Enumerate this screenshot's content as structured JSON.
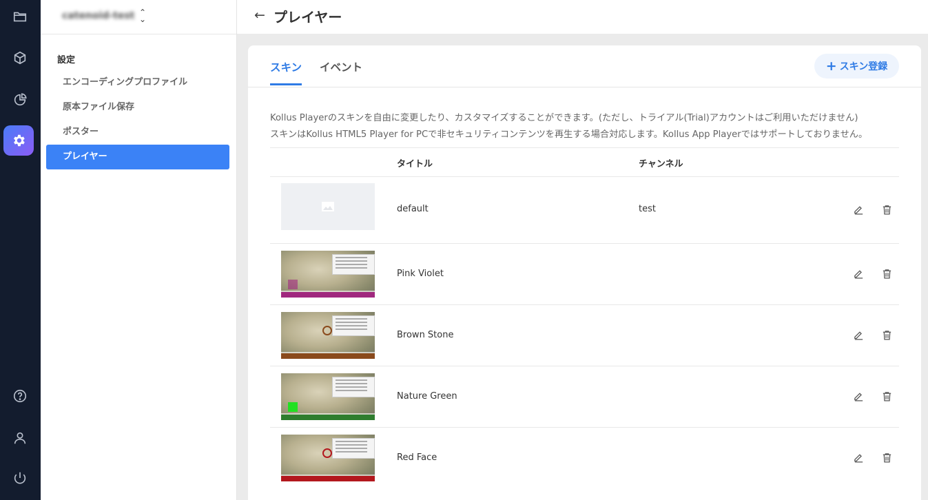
{
  "rail": {
    "items": [
      {
        "icon": "folder-icon"
      },
      {
        "icon": "cube-icon"
      },
      {
        "icon": "pie-chart-icon"
      },
      {
        "icon": "gear-icon"
      },
      {
        "icon": "help-icon"
      },
      {
        "icon": "user-icon"
      },
      {
        "icon": "power-icon"
      }
    ],
    "active_color": "#4a7cf7"
  },
  "sidebar": {
    "workspace": "catenoid-test",
    "section": "設定",
    "items": [
      {
        "label": "エンコーディングプロファイル"
      },
      {
        "label": "原本ファイル保存"
      },
      {
        "label": "ポスター"
      },
      {
        "label": "プレイヤー"
      }
    ]
  },
  "header": {
    "back_icon": "arrow-left-icon",
    "title": "プレイヤー"
  },
  "tabs": [
    {
      "label": "スキン"
    },
    {
      "label": "イベント"
    }
  ],
  "add_button": {
    "label": "スキン登録",
    "icon": "plus-icon"
  },
  "description": {
    "line1": "Kollus Playerのスキンを自由に変更したり、カスタマイズすることができます。(ただし、トライアル(Trial)アカウントはご利用いただけません)",
    "line2": "スキンはKollus HTML5 Player for PCで非セキュリティコンテンツを再生する場合対応します。Kollus App Playerではサポートしておりません。"
  },
  "table": {
    "headers": {
      "title": "タイトル",
      "channel": "チャンネル"
    },
    "rows": [
      {
        "title": "default",
        "channel": "test",
        "thumb": "placeholder",
        "accent": "#eef0f3"
      },
      {
        "title": "Pink Violet",
        "channel": "",
        "thumb": "video",
        "accent": "#a0287e"
      },
      {
        "title": "Brown Stone",
        "channel": "",
        "thumb": "video",
        "accent": "#8a4a1c"
      },
      {
        "title": "Nature Green",
        "channel": "",
        "thumb": "video",
        "accent": "#2e7d2e"
      },
      {
        "title": "Red Face",
        "channel": "",
        "thumb": "video",
        "accent": "#b3171d"
      }
    ]
  },
  "colors": {
    "primary": "#3b82f6",
    "tab_active": "#2f7be5",
    "rail_bg": "#131c2e"
  }
}
